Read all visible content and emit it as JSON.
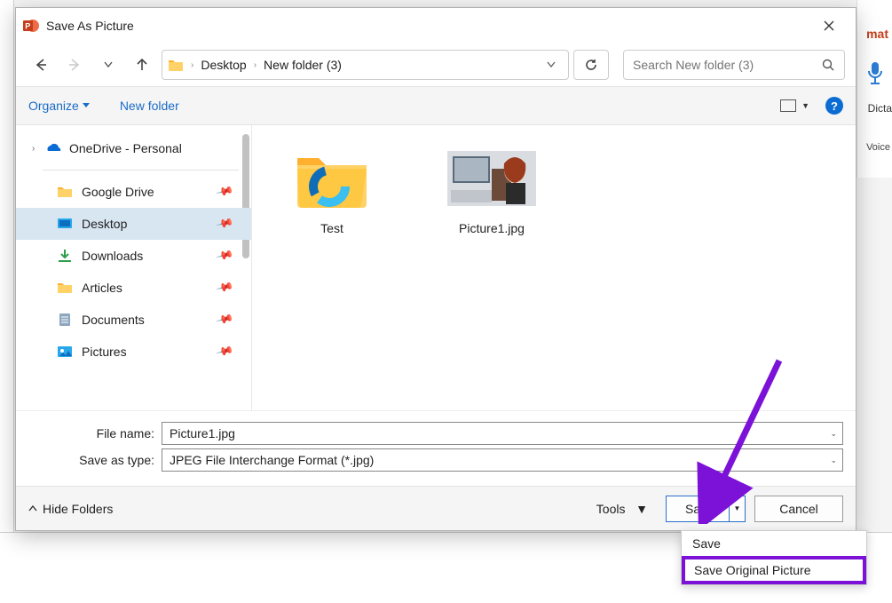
{
  "bg": {
    "format_tab": "mat",
    "dictate": "Dicta",
    "voice": "Voice"
  },
  "dialog": {
    "title": "Save As Picture",
    "breadcrumbs": [
      "Desktop",
      "New folder (3)"
    ],
    "search_placeholder": "Search New folder (3)",
    "toolbar": {
      "organize": "Organize",
      "new_folder": "New folder"
    },
    "sidebar": {
      "onedrive": "OneDrive - Personal",
      "items": [
        {
          "label": "Google Drive",
          "icon": "folder"
        },
        {
          "label": "Desktop",
          "icon": "desktop",
          "selected": true
        },
        {
          "label": "Downloads",
          "icon": "download"
        },
        {
          "label": "Articles",
          "icon": "folder"
        },
        {
          "label": "Documents",
          "icon": "document"
        },
        {
          "label": "Pictures",
          "icon": "pictures"
        }
      ]
    },
    "content": {
      "items": [
        {
          "name": "Test",
          "type": "folder"
        },
        {
          "name": "Picture1.jpg",
          "type": "image"
        }
      ]
    },
    "form": {
      "filename_label": "File name:",
      "filename_value": "Picture1.jpg",
      "type_label": "Save as type:",
      "type_value": "JPEG File Interchange Format (*.jpg)"
    },
    "footer": {
      "hide_folders": "Hide Folders",
      "tools": "Tools",
      "save": "Save",
      "cancel": "Cancel"
    },
    "save_menu": {
      "save": "Save",
      "save_original": "Save Original Picture"
    }
  }
}
